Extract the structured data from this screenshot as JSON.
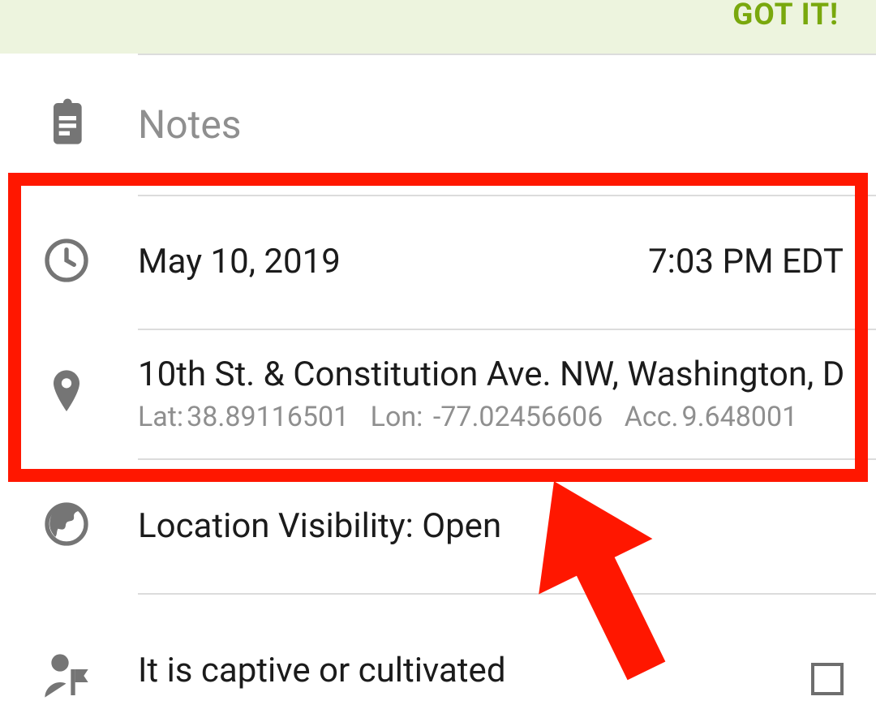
{
  "banner": {
    "confirm_label": "GOT IT!"
  },
  "notes": {
    "placeholder": "Notes"
  },
  "datetime": {
    "date": "May 10, 2019",
    "time": "7:03 PM EDT"
  },
  "location": {
    "address": "10th St. & Constitution Ave. NW, Washington, D",
    "lat_label": "Lat:",
    "lat_value": "38.89116501",
    "lon_label": "Lon:",
    "lon_value": "-77.02456606",
    "acc_label": "Acc.",
    "acc_value": "9.648001"
  },
  "visibility": {
    "label_prefix": "Location Visibility:",
    "value": "Open",
    "combined": "Location Visibility: Open"
  },
  "captive": {
    "label": "It is captive or cultivated",
    "checked": false
  }
}
